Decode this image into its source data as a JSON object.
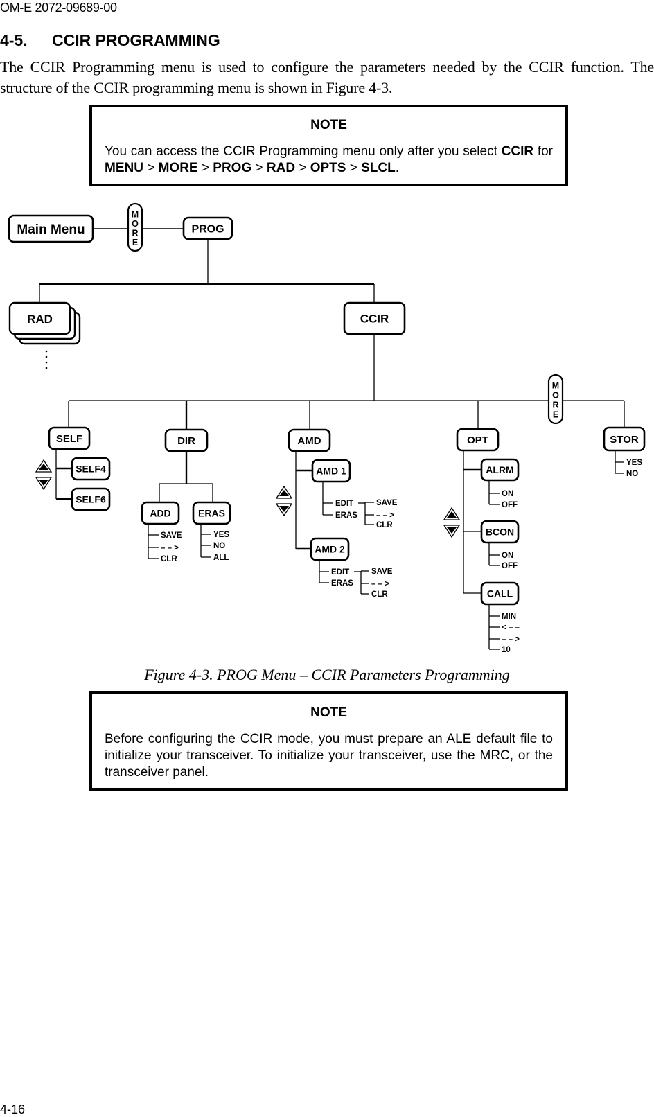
{
  "header": {
    "doc_id": "OM-E 2072-09689-00"
  },
  "section": {
    "number": "4-5.",
    "title": "CCIR PROGRAMMING",
    "intro": "The CCIR Programming menu is used to configure the parameters needed by the CCIR function. The structure of the CCIR programming menu is shown in Figure 4-3."
  },
  "note1": {
    "title": "NOTE",
    "body_prefix": "You can access the CCIR Programming menu only after you select ",
    "path": [
      {
        "text": "CCIR",
        "bold": true
      },
      {
        "text": " for ",
        "bold": false
      },
      {
        "text": "MENU",
        "bold": true
      },
      {
        "text": " > ",
        "bold": false
      },
      {
        "text": "MORE",
        "bold": true
      },
      {
        "text": " > ",
        "bold": false
      },
      {
        "text": "PROG",
        "bold": true
      },
      {
        "text": " > ",
        "bold": false
      },
      {
        "text": "RAD",
        "bold": true
      },
      {
        "text": " > ",
        "bold": false
      },
      {
        "text": "OPTS",
        "bold": true
      },
      {
        "text": " > ",
        "bold": false
      },
      {
        "text": "SLCL",
        "bold": true
      },
      {
        "text": ".",
        "bold": false
      }
    ]
  },
  "diagram": {
    "main_menu": "Main Menu",
    "more_label": "MORE",
    "prog": "PROG",
    "rad": "RAD",
    "ccir": "CCIR",
    "self": {
      "label": "SELF",
      "children": [
        "SELF4",
        "SELF6"
      ]
    },
    "dir": {
      "label": "DIR",
      "add": {
        "label": "ADD",
        "options": [
          "SAVE",
          "– – >",
          "CLR"
        ]
      },
      "eras": {
        "label": "ERAS",
        "options": [
          "YES",
          "NO",
          "ALL"
        ]
      }
    },
    "amd": {
      "label": "AMD",
      "entries": [
        {
          "label": "AMD 1",
          "actions": [
            "EDIT",
            "ERAS"
          ],
          "edit_options": [
            "SAVE",
            "– – >",
            "CLR"
          ]
        },
        {
          "label": "AMD 2",
          "actions": [
            "EDIT",
            "ERAS"
          ],
          "edit_options": [
            "SAVE",
            "– – >",
            "CLR"
          ]
        }
      ]
    },
    "opt": {
      "label": "OPT",
      "alrm": {
        "label": "ALRM",
        "options": [
          "ON",
          "OFF"
        ]
      },
      "bcon": {
        "label": "BCON",
        "options": [
          "ON",
          "OFF"
        ]
      },
      "call": {
        "label": "CALL",
        "options": [
          "MIN",
          "< – –",
          "– – >",
          "10"
        ]
      }
    },
    "stor": {
      "label": "STOR",
      "options": [
        "YES",
        "NO"
      ]
    }
  },
  "caption": "Figure 4-3. PROG Menu – CCIR Parameters Programming",
  "note2": {
    "title": "NOTE",
    "body": "Before configuring the CCIR mode, you must prepare an ALE default file to initialize your transceiver. To initialize your transceiver, use the MRC, or the transceiver panel."
  },
  "footer": {
    "page_number": "4-16"
  }
}
